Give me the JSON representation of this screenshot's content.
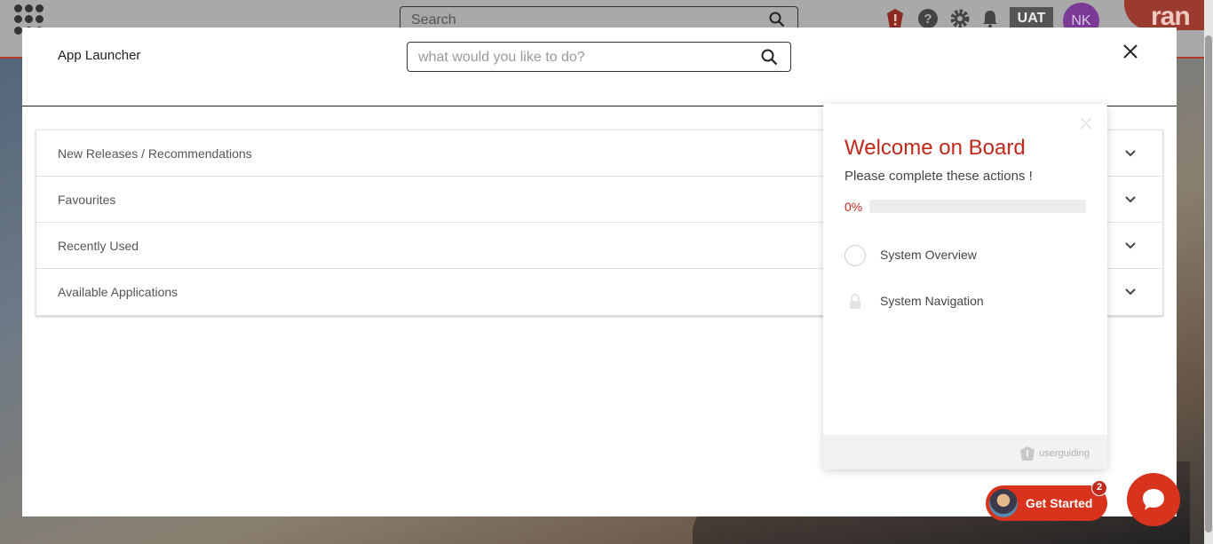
{
  "background": {
    "search_placeholder": "Search",
    "env_badge": "UAT",
    "user_initials": "NK",
    "brand_text": "ran"
  },
  "modal": {
    "title": "App Launcher",
    "search_placeholder": "what would you like to do?",
    "sections": [
      {
        "label": "New Releases / Recommendations"
      },
      {
        "label": "Favourites"
      },
      {
        "label": "Recently Used"
      },
      {
        "label": "Available Applications"
      }
    ]
  },
  "onboarding": {
    "title": "Welcome on Board",
    "subtitle": "Please complete these actions !",
    "progress_label": "0%",
    "progress": 0,
    "items": [
      {
        "label": "System Overview",
        "state": "open"
      },
      {
        "label": "System Navigation",
        "state": "locked"
      }
    ],
    "brand": "userguiding"
  },
  "launcher": {
    "label": "Get Started",
    "badge": "2"
  },
  "colors": {
    "accent": "#c0291b",
    "button": "#d8331c"
  }
}
